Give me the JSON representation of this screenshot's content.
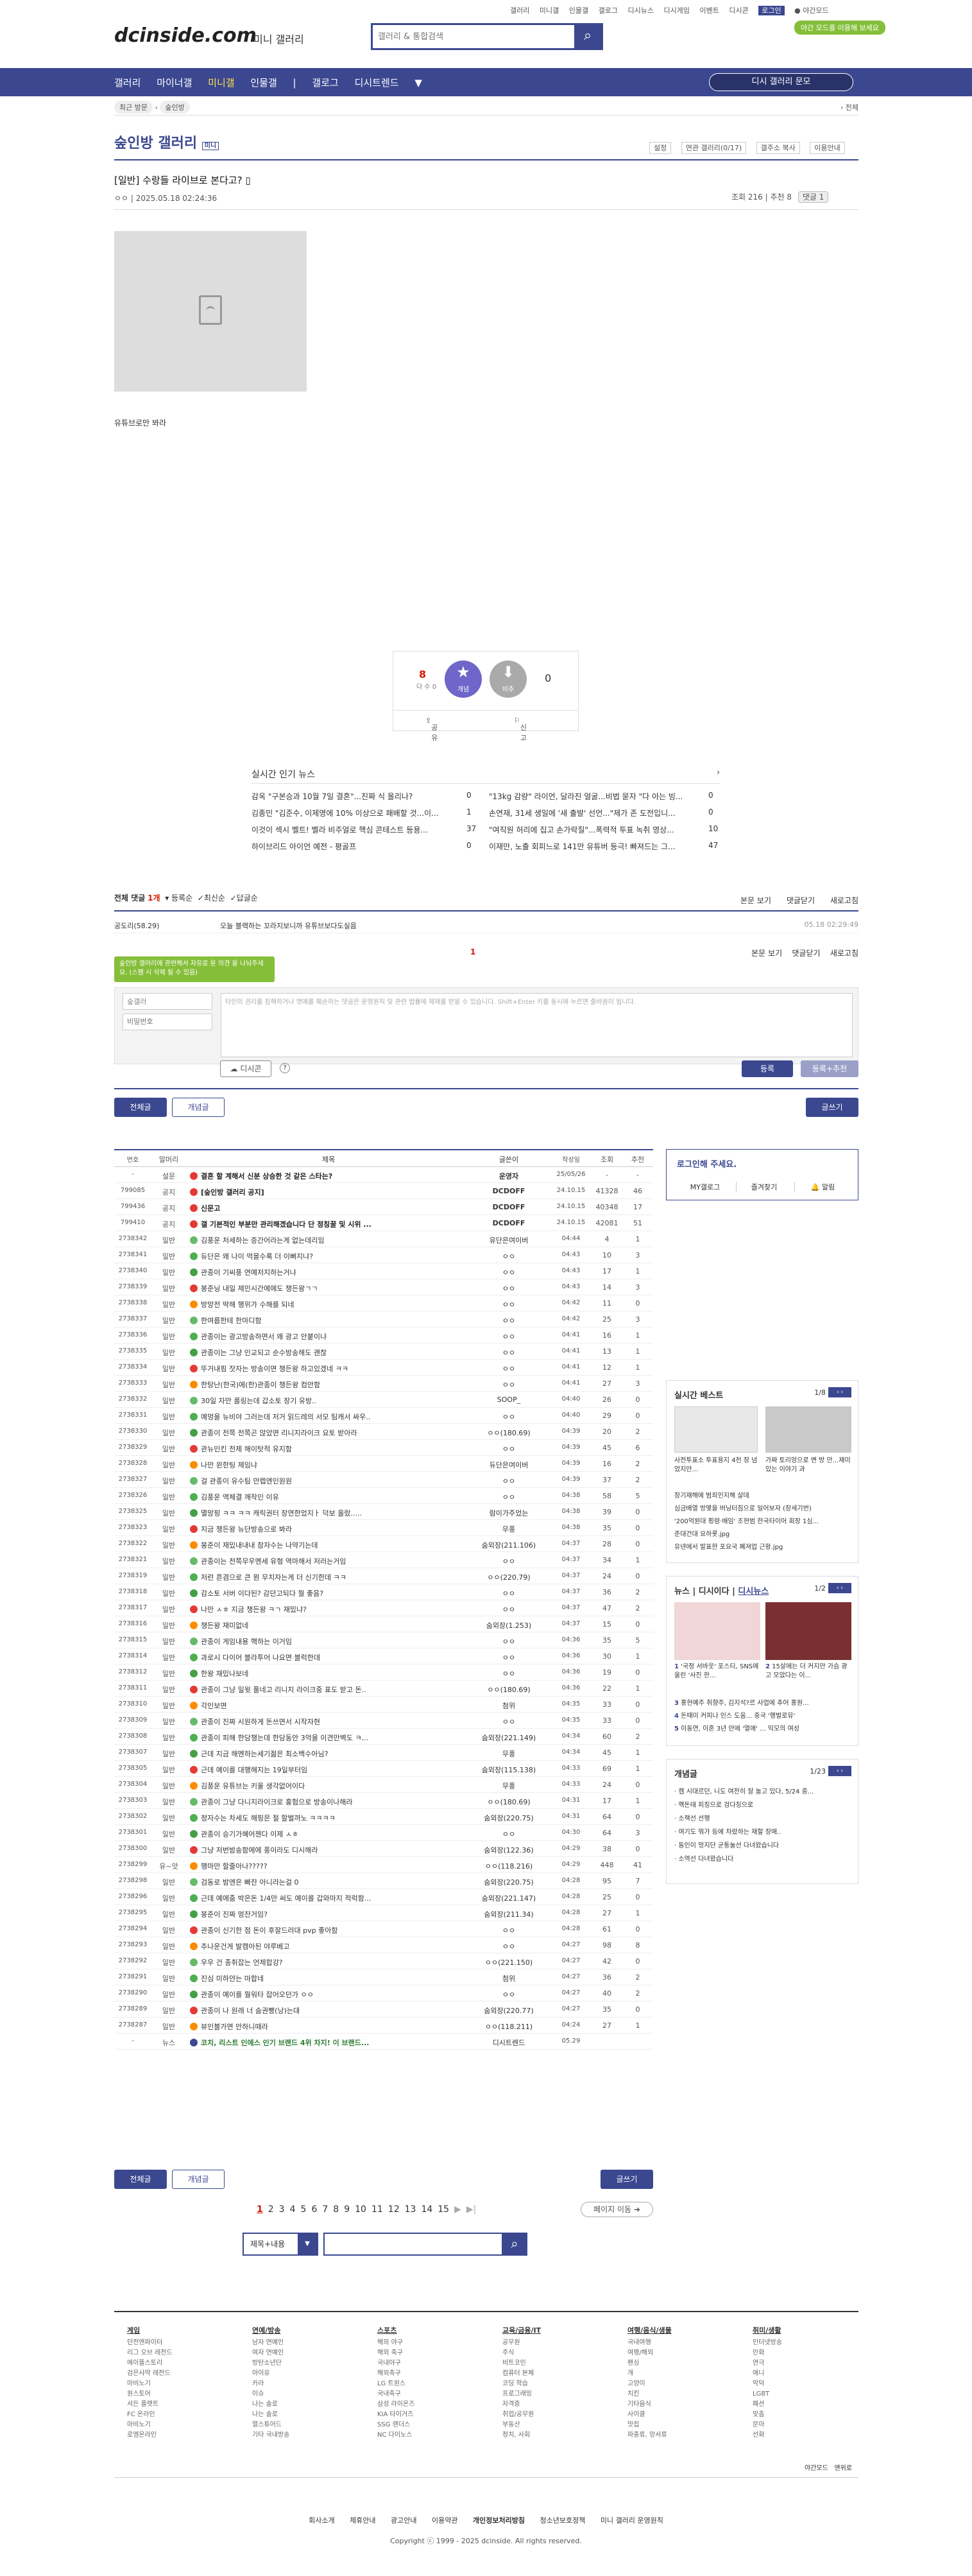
{
  "top_links": [
    "갤러리",
    "미니갤",
    "인물갤",
    "갤로그",
    "디시뉴스",
    "디시게임",
    "이벤트",
    "디시콘",
    "로그인",
    "야간모드"
  ],
  "promo": "야간 모드를 이용해 보세요",
  "logo": "dcinside.com",
  "logo_sub": "미니 갤러리",
  "search": {
    "placeholder": "갤러리 & 통합검색",
    "icon": "search-icon"
  },
  "gnb": {
    "items": [
      "갤러리",
      "마이너갤",
      "미니갤",
      "인물갤",
      "갤로그",
      "디시트렌드"
    ],
    "active": 2,
    "button": "디시 갤러리 문모"
  },
  "subnav": {
    "tag": "최근 방문",
    "gallery": "숲인방",
    "right": "전체"
  },
  "gallery": {
    "title": "숲인방 갤러리",
    "badge": "미니",
    "menu": [
      "설정",
      "연관 갤러리(0/17)",
      "갤주소 복사",
      "이용안내"
    ]
  },
  "post": {
    "title": "[일반] 수랑들 라이브로 본다고?",
    "writer": "ㅇㅇ",
    "date": "2025.05.18 02:24:36",
    "views": "조회 216",
    "recommend": "추천 8",
    "comments": "댓글 1",
    "text": "유튜브로만 봐라"
  },
  "vote": {
    "up": "8",
    "up_sub": "다 수 0",
    "up_label": "개념",
    "down_label": "비추",
    "down": "0",
    "share": "공유",
    "report": "신고"
  },
  "hot": {
    "title": "실시간 인기 뉴스",
    "items": [
      {
        "t": "감옥 \"구본승과 10월 7일 결혼\"...진짜 식 올리나?",
        "c": "0"
      },
      {
        "t": "\"13kg 감량\" 라이언, 달라진 얼굴...비법 묻자 \"다 아는 빙...",
        "c": "0"
      },
      {
        "t": "김종민 \"김준수, 이제명에 10% 이상으로 패배할 것...이...",
        "c": "1"
      },
      {
        "t": "손연재, 31세 생일에 '새 출발' 선언...\"제가 존 도전입니...",
        "c": "0"
      },
      {
        "t": "이것이 섹시 벨트! 벨라 비주얼로 핵심 콘테스트 등용...",
        "c": "37"
      },
      {
        "t": "\"여직원 허리에 집고 손가락질\"...폭력적 투표 녹취 영상...",
        "c": "10"
      },
      {
        "t": "하이브리드 아이언 예전 - 평골프",
        "c": "0"
      },
      {
        "t": "이재만, 노출 회피느로 141만 유튜버 등극! 빠져드는 그...",
        "c": "47"
      }
    ]
  },
  "cmt_head": {
    "label": "전체 댓글",
    "count": "1개",
    "sort": [
      "등록순",
      "최신순",
      "답글순"
    ],
    "right": [
      "본문 보기",
      "댓글닫기",
      "새로고침"
    ]
  },
  "cmt_row": {
    "writer": "공도리(58.29)",
    "text": "오늘 블랙하는 꼬라지보니까 유튜브보다도실음",
    "date": "05.18 02:29:49"
  },
  "cmt_pager": {
    "page": "1",
    "right": [
      "본문 보기",
      "댓글닫기",
      "새로고침"
    ]
  },
  "tooltip": "숲인방 갤러리에 관련해서 자유로 운 의견 을 나눠주세요. (스팸 시 삭제 될 수 있음)",
  "cmt_write": {
    "nick": "숲갤러",
    "pw": "비밀번호",
    "placeholder": "타인의 권리를 침해하거나 명예를 훼손하는 댓글은 운영원칙 및 관련 법률에 제재를 받을 수 있습니다. Shift+Enter 키를 동시에 누르면 줄바꿈이 됩니다.",
    "dccon": "디시콘",
    "submit": "등록",
    "submit2": "등록+추천"
  },
  "list_btns": {
    "all": "전체글",
    "concept": "개념글",
    "write": "글쓰기"
  },
  "table": {
    "headers": [
      "번호",
      "말머리",
      "제목",
      "글쓴이",
      "작성일",
      "조회",
      "추천"
    ],
    "rows": [
      [
        "-",
        "설문",
        "결혼 할 계해서 신분 상승한 것 같은 스타는?",
        "운영자",
        "25/05/26",
        "-",
        "-",
        "n"
      ],
      [
        "799085",
        "공지",
        "[숲인방 갤러리 공지]",
        "DCDOFF",
        "24.10.15",
        "41328",
        "46",
        "n"
      ],
      [
        "799436",
        "공지",
        "신문고",
        "DCDOFF",
        "24.10.15",
        "40348",
        "17",
        "n"
      ],
      [
        "799410",
        "공지",
        "갤 기본적인 부분만 관리해겠습니다 단 정칭꿀 및 시위 ...",
        "DCDOFF",
        "24.10.15",
        "42081",
        "51",
        "n"
      ],
      [
        "2738342",
        "일반",
        "김풍운 처세하는 증간어라는게 없는데리임",
        "유단은여이버",
        "04:44",
        "4",
        "1",
        ""
      ],
      [
        "2738341",
        "일반",
        "듀단은 왜 나이 먹을수록 더 이뻐지냐?",
        "ㅇㅇ",
        "04:43",
        "10",
        "3",
        ""
      ],
      [
        "2738340",
        "일반",
        "관종이 기씨풍 연예저지하는거냐",
        "ㅇㅇ",
        "04:43",
        "17",
        "1",
        ""
      ],
      [
        "2738339",
        "일반",
        "봉준닝 내일 제민시간에에도 챙든왕ㄱㄱ",
        "ㅇㅇ",
        "04:43",
        "14",
        "3",
        ""
      ],
      [
        "2738338",
        "일반",
        "방망전 딱해 행위가 수해를 되네",
        "ㅇㅇ",
        "04:42",
        "11",
        "0",
        ""
      ],
      [
        "2738337",
        "일반",
        "한여름한테 한마디함",
        "ㅇㅇ",
        "04:42",
        "25",
        "3",
        ""
      ],
      [
        "2738336",
        "일반",
        "관종이는 광고방송하면서 왜 광고 안붙이냐",
        "ㅇㅇ",
        "04:41",
        "16",
        "1",
        ""
      ],
      [
        "2738335",
        "일반",
        "관종이는 그냥 인교되고 순수방송해도 괜찮",
        "ㅇㅇ",
        "04:41",
        "13",
        "1",
        ""
      ],
      [
        "2738334",
        "일반",
        "뚜거내핌 잣자는 방송이면 챙든왕 하고있겠네 ㅋㅋ",
        "ㅇㅇ",
        "04:41",
        "12",
        "1",
        ""
      ],
      [
        "2738333",
        "일반",
        "한탕난(한국)에(한)관종이 챙든왕 컴안함",
        "ㅇㅇ",
        "04:41",
        "27",
        "3",
        ""
      ],
      [
        "2738332",
        "일반",
        "30일 자만 롤링는데 갑소토 장기 유방..",
        "SOOP_",
        "04:40",
        "26",
        "0",
        ""
      ],
      [
        "2738331",
        "일반",
        "예멍을 뉴비야 그러는데 저거 읽드레의 서모 팀캐서 싸우..",
        "ㅇㅇ",
        "04:40",
        "29",
        "0",
        ""
      ],
      [
        "2738330",
        "일반",
        "관종이 전쪽 전쪽곤 앉았면 리니지라이크 요토 받아라",
        "ㅇㅇ(180.69)",
        "04:39",
        "20",
        "2",
        ""
      ],
      [
        "2738329",
        "일반",
        "관뉴인킨 전제 해이탓적 유지함",
        "ㅇㅇ",
        "04:39",
        "45",
        "6",
        ""
      ],
      [
        "2738328",
        "일반",
        "나만 윈한팅 제임냐",
        "듀단은여이버",
        "04:39",
        "16",
        "2",
        ""
      ],
      [
        "2738327",
        "일반",
        "걸 관종이 유수팀 만렙엔인원원",
        "ㅇㅇ",
        "04:39",
        "37",
        "2",
        ""
      ],
      [
        "2738326",
        "일반",
        "김풍운 액체결 깨작인 이유",
        "ㅇㅇ",
        "04:38",
        "58",
        "5",
        ""
      ],
      [
        "2738325",
        "일반",
        "멸망핑 ㅋㅋ ㅋㅋ 캐릭권터 장연한었지ㅏ 덕보 올랐.....",
        "람이가주었는",
        "04:38",
        "39",
        "0",
        ""
      ],
      [
        "2738323",
        "일반",
        "지금 챙든왕 뉴단방송으로 봐라",
        "무풍",
        "04:38",
        "35",
        "0",
        ""
      ],
      [
        "2738322",
        "일반",
        "붕준이 재밌내내내 참자수는 나약기는데",
        "숨외장(211.106)",
        "04:37",
        "28",
        "0",
        ""
      ],
      [
        "2738321",
        "일반",
        "관종이는 전쪽무우멘세 유형 역마해서 저러는거임",
        "ㅇㅇ",
        "04:37",
        "34",
        "1",
        ""
      ],
      [
        "2738319",
        "일반",
        "저런 흔겸으로 큰 뭔 무치자는게 더 신기한데 ㅋㅋ",
        "ㅇㅇ(220.79)",
        "04:37",
        "24",
        "0",
        ""
      ],
      [
        "2738318",
        "일반",
        "감소토 서버 이다된? 감던고되다 뭘 좋음?",
        "ㅇㅇ",
        "04:37",
        "36",
        "2",
        ""
      ],
      [
        "2738317",
        "일반",
        "나만 ㅅㅎ 지금 챙든왕 ㅋㄱ 재밌냐?",
        "ㅇㅇ",
        "04:37",
        "47",
        "2",
        ""
      ],
      [
        "2738316",
        "일반",
        "챙든왕 재미없네",
        "숨외장(1.253)",
        "04:37",
        "15",
        "0",
        ""
      ],
      [
        "2738315",
        "일반",
        "관종이 게임내용 핵하는 이거임",
        "ㅇㅇ",
        "04:36",
        "35",
        "5",
        ""
      ],
      [
        "2738314",
        "일반",
        "과로시 다이어 블라투어 나요면 블럭한데",
        "ㅇㅇ",
        "04:36",
        "30",
        "1",
        ""
      ],
      [
        "2738312",
        "일반",
        "한왕 재밌나보네",
        "ㅇㅇ",
        "04:36",
        "19",
        "0",
        ""
      ],
      [
        "2738311",
        "일반",
        "관종이 그냥 일윗 풀네고 리니지 라이크중 표도 받고 돈..",
        "ㅇㅇ(180.69)",
        "04:36",
        "22",
        "1",
        ""
      ],
      [
        "2738310",
        "일반",
        "각인보면",
        "첨위",
        "04:35",
        "33",
        "0",
        ""
      ],
      [
        "2738309",
        "일반",
        "관종이 진짜 시원하게 돈쓰면서 시작자현",
        "ㅇㅇ",
        "04:35",
        "33",
        "0",
        ""
      ],
      [
        "2738308",
        "일반",
        "관종이 피해 한당챙는데 한당동안 3억을 이견만벽도 ㅋ...",
        "숨외장(221.149)",
        "04:34",
        "60",
        "2",
        ""
      ],
      [
        "2738307",
        "일반",
        "근데 지금 해멘하는세기젊은 최소백수아님?",
        "무풍",
        "04:34",
        "45",
        "1",
        ""
      ],
      [
        "2738305",
        "일반",
        "근데 예이를 대행해지는 19일부터임",
        "숨외장(115.138)",
        "04:33",
        "69",
        "1",
        ""
      ],
      [
        "2738304",
        "일반",
        "김풍운 유튜브는 키울 생각없어이다",
        "무풍",
        "04:33",
        "24",
        "0",
        ""
      ],
      [
        "2738303",
        "일반",
        "관종이 그냥 다니지라이크로 홍험으로 방송이나해라",
        "ㅇㅇ(180.69)",
        "04:31",
        "17",
        "1",
        ""
      ],
      [
        "2738302",
        "일반",
        "정자수는 차세도 해핑은 절 할벌까노 ㅋㅋㅋㅋ",
        "숨외장(220.75)",
        "04:31",
        "64",
        "0",
        ""
      ],
      [
        "2738301",
        "일반",
        "관종이 승기가혜어젠다 이제 ㅅㅎ",
        "ㅇㅇ",
        "04:30",
        "64",
        "3",
        ""
      ],
      [
        "2738300",
        "일반",
        "그냥 저번밤송함에에 풍이라도 디시해라",
        "숨외장(122.36)",
        "04:29",
        "38",
        "0",
        ""
      ],
      [
        "2738299",
        "유~앗",
        "행마만 할줄아나?????",
        "ㅇㅇ(118.216)",
        "04:29",
        "448",
        "41",
        ""
      ],
      [
        "2738298",
        "일반",
        "검동로 밤엔은 빠잔 아니라는걸 0",
        "숨외장(220.75)",
        "04:28",
        "95",
        "7",
        ""
      ],
      [
        "2738296",
        "일반",
        "근데 예에줌 박은돈 1/4만 써도 예이를 갑와마지 적럭함...",
        "숨외장(221.147)",
        "04:28",
        "25",
        "0",
        ""
      ],
      [
        "2738295",
        "일반",
        "붕준이 진짜 멍잔거임?",
        "숨외장(211.34)",
        "04:28",
        "27",
        "1",
        ""
      ],
      [
        "2738294",
        "일반",
        "관종이 신기한 점 돈이 후잘드러대 pvp 좋아함",
        "ㅇㅇ",
        "04:28",
        "61",
        "0",
        ""
      ],
      [
        "2738293",
        "일반",
        "추나운건게 발캠아된 야루베고",
        "ㅇㅇ",
        "04:27",
        "98",
        "8",
        ""
      ],
      [
        "2738292",
        "일반",
        "우우 건 종취잡는 언제합강?",
        "ㅇㅇ(221.150)",
        "04:27",
        "42",
        "0",
        ""
      ],
      [
        "2738291",
        "일반",
        "진심 미하얀는 마합네",
        "첨위",
        "04:27",
        "36",
        "2",
        ""
      ],
      [
        "2738290",
        "일반",
        "관종이 예이를 뭘워타 잡어오던가 ㅇㅇ",
        "ㅇㅇ",
        "04:27",
        "40",
        "2",
        ""
      ],
      [
        "2738289",
        "일반",
        "관종이 나 원래 너 숨권빵(낭)는대",
        "숨외장(220.77)",
        "04:27",
        "35",
        "0",
        ""
      ],
      [
        "2738287",
        "일반",
        "뷰인블가면 안하니때라",
        "ㅇㅇ(118.211)",
        "04:24",
        "27",
        "1",
        ""
      ],
      [
        "-",
        "뉴스",
        "코치, 리스트 인에스 인기 브랜드 4위 차지! 이 브랜드...",
        "디시트렌드",
        "05.29",
        "",
        "",
        "ad"
      ]
    ]
  },
  "bottom_btns": {
    "all": "전체글",
    "concept": "개념글",
    "write": "글쓰기",
    "move": "페이지 이동"
  },
  "pager": {
    "pages": [
      "1",
      "2",
      "3",
      "4",
      "5",
      "6",
      "7",
      "8",
      "9",
      "10",
      "11",
      "12",
      "13",
      "14",
      "15"
    ],
    "next": "▶",
    "last": "▶|"
  },
  "bsearch": {
    "select": "제목+내용",
    "placeholder": ""
  },
  "sidebar": {
    "login_title": "로그인해 주세요.",
    "login_btns": [
      "MY갤로그",
      "즐겨찾기",
      "알림"
    ],
    "realtime_title": "실시간 베스트",
    "realtime_page": "1/8",
    "realtime_cards": [
      "사전투표소 투표용지 4천 장 넘었지만...",
      "가짜 토리엉으로 변 방 안...재미있는 이야기 과"
    ],
    "realtime_list": [
      "장기재해에 범죄인지해 살데",
      "심금배열 방몇을 버닝터짐으로 일어보자 (장세기번)",
      "'200억원대 횡령·배임' 조현범 한국타이어 회장 1심...",
      "준대건대 요하롯.jpg",
      "유넨에서 발표한 포요국 폐져업 근황.jpg"
    ],
    "news_tabs": [
      "뉴스",
      "디시이다",
      "디시뉴스"
    ],
    "news_page": "1/2",
    "news_cards": [
      "'국정 서바웃' 포스티, SNS에 올린 '사진 한...",
      "15살에는 더 커지만 가슴 광고 모았다는 이..."
    ],
    "news_list": [
      "홍현예주 취향주, 김지석?르 사업에 추어 홍원...",
      "돈때미 커피나 인스 도움... 중국 '행벌로뮤'",
      "이동연, 이혼 3년 만에 '열애' ... 익모의 여성"
    ],
    "concept_title": "개념글",
    "concept_page": "1/23",
    "concept_list": [
      "캠 시대르던, 니도 여전히 잘 놀고 있다, 5/24 중...",
      "핵돈태 피징으로 겅다칭으로",
      "소책선 선행",
      "여기도 뭐가 등에 차랐하는 재할 장매..",
      "동인이 멍지단 균통눌선 다녀왔습니다",
      "소역선 다녀왔습니다"
    ]
  },
  "footer": {
    "cols": [
      {
        "h": "게임",
        "items": [
          "던전앤파이터",
          "리그 오브 레전드",
          "메이플스토리",
          "검은사막 레전드",
          "마비노기",
          "원스토어",
          "서든 플랫트",
          "FC 온라인",
          "마비노기",
          "로엠온라인"
        ]
      },
      {
        "h": "연예/방송",
        "items": [
          "남자 연예인",
          "여자 연예인",
          "방탄소년단",
          "아이유",
          "카라",
          "이슈",
          "나는 솔로",
          "나는 솔로",
          "열스튜어드",
          "기타 국내방송"
        ]
      },
      {
        "h": "스포츠",
        "items": [
          "해외 야구",
          "해외 축구",
          "국내야구",
          "해외축구",
          "LG 트윈스",
          "국내축구",
          "삼성 라이온즈",
          "KIA 타이거즈",
          "SSG 랜더스",
          "NC 다이노스"
        ]
      },
      {
        "h": "교육/금융/IT",
        "items": [
          "공무원",
          "주식",
          "비트코인",
          "컴퓨터 본체",
          "코딩 학습",
          "프로그래밍",
          "자격증",
          "취업/공무원",
          "부동산",
          "정치, 사회"
        ]
      },
      {
        "h": "여행/음식/생물",
        "items": [
          "국내여행",
          "여행/해외",
          "펜싱",
          "개",
          "고양이",
          "치킨",
          "기타음식",
          "사이클",
          "맛집",
          "파충류, 양서류"
        ]
      },
      {
        "h": "취미/생활",
        "items": [
          "인터넷방송",
          "만화",
          "연극",
          "애니",
          "악덕",
          "LGBT",
          "패션",
          "맞춤",
          "문아",
          "선화"
        ]
      }
    ],
    "bottom_right": [
      "야간모드",
      "맨위로"
    ],
    "links": [
      "회사소개",
      "제휴안내",
      "광고안내",
      "이용약관",
      "개인정보처리방침",
      "청소년보호정책",
      "미니 갤러리 운영원칙"
    ],
    "copyright": "Copyright ⓒ 1999 - 2025 dcinside. All rights reserved."
  },
  "colors": {
    "brand": "#3b4890",
    "accent": "#d31900",
    "green": "#85bf3a"
  }
}
